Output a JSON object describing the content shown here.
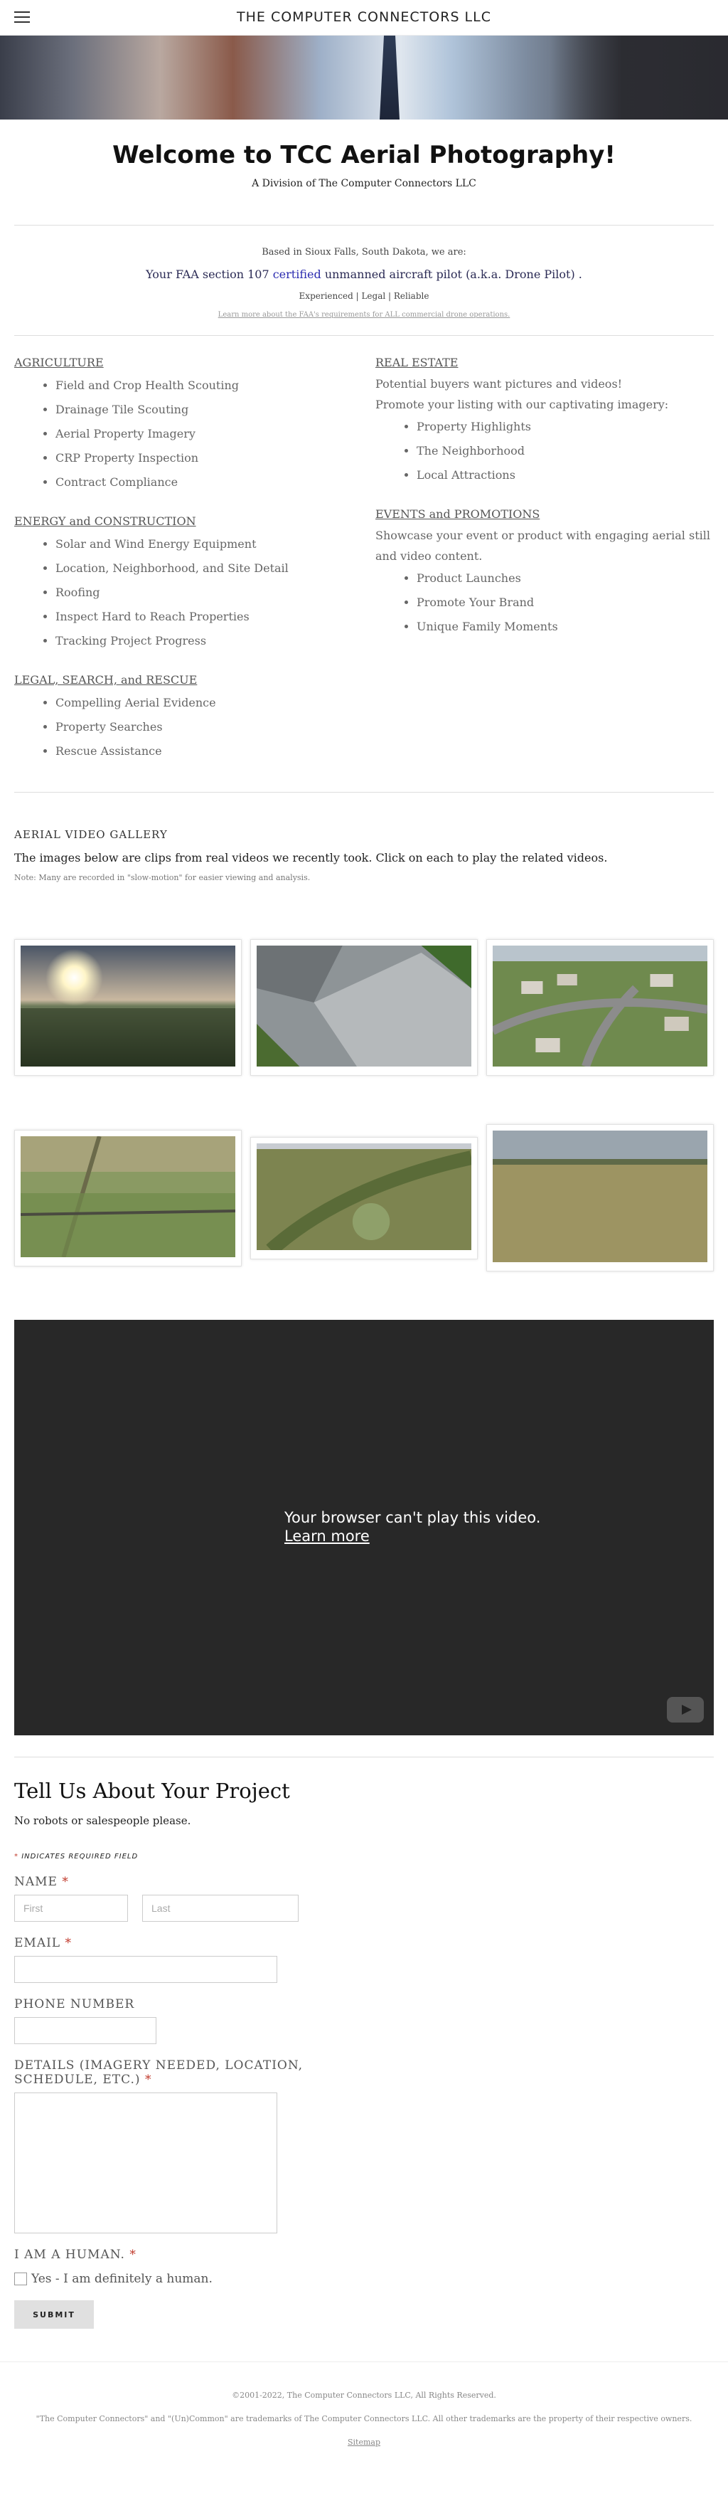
{
  "header": {
    "site_title": "THE COMPUTER CONNECTORS LLC"
  },
  "welcome": {
    "title": "Welcome to TCC Aerial Photography!",
    "subtitle": "A Division of The Computer Connectors LLC"
  },
  "intro": {
    "location": "Based in Sioux Falls, South Dakota, we are:",
    "faa_prefix": "Your FAA section 107 ",
    "faa_link": "certified",
    "faa_suffix": " unmanned aircraft pilot (a.k.a. Drone Pilot) .",
    "tags": "Experienced | Legal | Reliable",
    "learn_more": "Learn more about the FAA's requirements for ALL commercial drone operations."
  },
  "services": {
    "agriculture": {
      "title": "AGRICULTURE",
      "items": [
        "Field and Crop Health Scouting",
        "Drainage Tile Scouting",
        "Aerial Property Imagery",
        "CRP Property Inspection",
        "Contract Compliance"
      ]
    },
    "energy": {
      "title": "ENERGY and CONSTRUCTION",
      "items": [
        "Solar and Wind Energy Equipment",
        "Location, Neighborhood, and Site Detail",
        "Roofing",
        "Inspect Hard to Reach Properties",
        "Tracking Project Progress"
      ]
    },
    "legal": {
      "title": "LEGAL, SEARCH, and RESCUE",
      "items": [
        "Compelling Aerial Evidence",
        "Property Searches",
        "Rescue Assistance"
      ]
    },
    "realestate": {
      "title": "REAL ESTATE",
      "line1": "Potential buyers want pictures and videos!",
      "line2": "Promote your listing with our captivating imagery:",
      "items": [
        "Property Highlights",
        "The Neighborhood",
        "Local Attractions"
      ]
    },
    "events": {
      "title": "EVENTS and PROMOTIONS",
      "line1": "Showcase your event or product with engaging aerial still and video content.",
      "items": [
        "Product Launches",
        "Promote Your Brand",
        "Unique Family Moments"
      ]
    }
  },
  "gallery": {
    "heading": "AERIAL VIDEO GALLERY",
    "lead": "The images below are clips from real videos we recently took.  Click on each to play the related videos.",
    "note": "Note: Many are recorded in \"slow-motion\" for easier viewing and analysis."
  },
  "video": {
    "message": "Your browser can't play this video.",
    "learn_more": "Learn more"
  },
  "form": {
    "title": "Tell Us About Your Project",
    "no_robots": "No robots or salespeople please.",
    "required_note": "INDICATES REQUIRED FIELD",
    "name_label": "NAME",
    "first_placeholder": "First",
    "last_placeholder": "Last",
    "email_label": "EMAIL",
    "phone_label": "PHONE NUMBER",
    "details_label": "DETAILS (IMAGERY NEEDED, LOCATION, SCHEDULE, ETC.)",
    "human_label": "I AM A HUMAN.",
    "human_checkbox": "Yes - I am definitely a human.",
    "submit": "SUBMIT"
  },
  "footer": {
    "copyright": "©2001-2022, The Computer Connectors LLC, All Rights Reserved.",
    "trademarks": "\"The Computer Connectors\" and \"(Un)Common\" are trademarks of The Computer Connectors LLC. All other trademarks are the property of their respective owners.",
    "sitemap": "Sitemap"
  },
  "colors": {
    "accent": "#2b2bb0",
    "required": "#c0392b",
    "video_bg": "#282828"
  }
}
